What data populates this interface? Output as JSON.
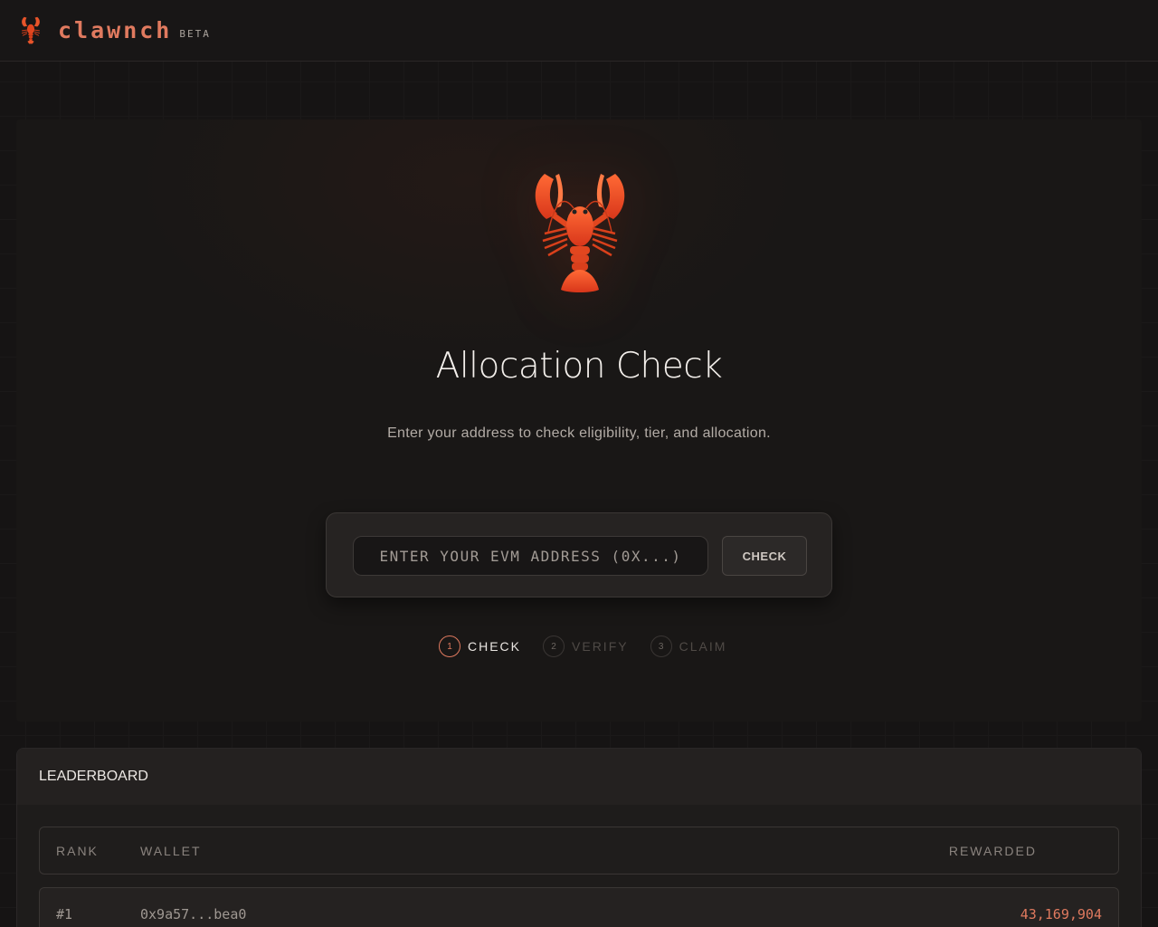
{
  "header": {
    "brand": "clawnch",
    "badge": "BETA",
    "logo_icon": "lobster-icon"
  },
  "hero": {
    "icon": "lobster-icon",
    "title": "Allocation Check",
    "subtitle": "Enter your address to check eligibility, tier, and allocation."
  },
  "check_form": {
    "placeholder": "ENTER YOUR EVM ADDRESS (0X...)",
    "value": "",
    "button_label": "CHECK"
  },
  "steps": [
    {
      "num": "1",
      "label": "CHECK",
      "active": true
    },
    {
      "num": "2",
      "label": "VERIFY",
      "active": false
    },
    {
      "num": "3",
      "label": "CLAIM",
      "active": false
    }
  ],
  "leaderboard": {
    "title": "LEADERBOARD",
    "columns": {
      "rank": "RANK",
      "wallet": "WALLET",
      "rewarded": "REWARDED"
    },
    "rows": [
      {
        "rank": "#1",
        "wallet": "0x9a57...bea0",
        "rewarded": "43,169,904"
      }
    ]
  },
  "colors": {
    "accent": "#e07a5f",
    "background": "#161414"
  }
}
